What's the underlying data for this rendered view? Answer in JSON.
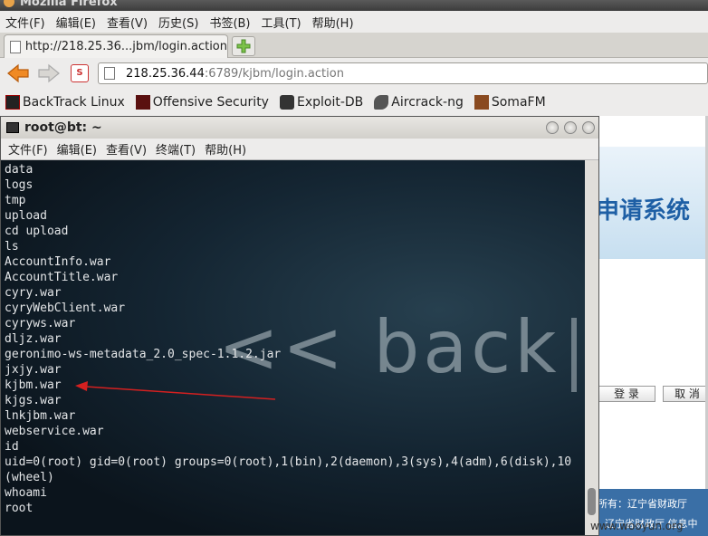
{
  "firefox": {
    "title": "Mozilla Firefox",
    "menu": [
      "文件(F)",
      "编辑(E)",
      "查看(V)",
      "历史(S)",
      "书签(B)",
      "工具(T)",
      "帮助(H)"
    ],
    "tab_label": "http://218.25.36...jbm/login.action",
    "url_host": "218.25.36.44",
    "url_rest": ":6789/kjbm/login.action",
    "bookmarks": [
      "BackTrack Linux",
      "Offensive Security",
      "Exploit-DB",
      "Aircrack-ng",
      "SomaFM"
    ]
  },
  "site": {
    "banner_text": "申请系统",
    "login_button": "登 录",
    "cancel_button": "取 消",
    "footer_line1": "所有：辽宁省财政厅",
    "footer_line2": "辽宁省财政厅 信息中"
  },
  "terminal": {
    "title": "root@bt: ~",
    "menu": [
      "文件(F)",
      "编辑(E)",
      "查看(V)",
      "终端(T)",
      "帮助(H)"
    ],
    "background_logo": "<< back",
    "lines": [
      "data",
      "logs",
      "tmp",
      "upload",
      "cd upload",
      "ls",
      "AccountInfo.war",
      "AccountTitle.war",
      "cyry.war",
      "cyryWebClient.war",
      "cyryws.war",
      "dljz.war",
      "geronimo-ws-metadata_2.0_spec-1.1.2.jar",
      "jxjy.war",
      "kjbm.war",
      "kjgs.war",
      "lnkjbm.war",
      "webservice.war",
      "id",
      "uid=0(root) gid=0(root) groups=0(root),1(bin),2(daemon),3(sys),4(adm),6(disk),10",
      "(wheel)",
      "whoami",
      "root"
    ],
    "annotation_color": "#d42020"
  },
  "watermark": "www.wooyun.org"
}
